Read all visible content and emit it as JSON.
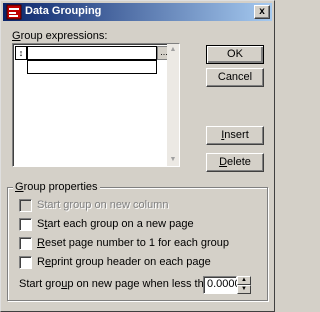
{
  "window": {
    "title": "Data Grouping",
    "close_glyph": "x"
  },
  "expressions": {
    "label_u": "G",
    "label_rest": "roup expressions:",
    "row_header_glyph": "↕",
    "ellipsis_button": "...",
    "scroll_up_glyph": "▲",
    "scroll_down_glyph": "▼"
  },
  "buttons": {
    "ok": "OK",
    "cancel": "Cancel",
    "insert_u": "I",
    "insert_rest": "nsert",
    "delete_u": "D",
    "delete_rest": "elete"
  },
  "group_properties": {
    "title_u": "G",
    "title_rest": "roup properties",
    "start_new_column": "Start group on new column",
    "start_new_page_pre": "S",
    "start_new_page_u": "t",
    "start_new_page_rest": "art each group on a new page",
    "reset_page_u": "R",
    "reset_page_rest": "eset page number to 1 for each group",
    "reprint_header_pre": "R",
    "reprint_header_u": "e",
    "reprint_header_rest": "print group header on each page",
    "start_when_less_pre": "Start gro",
    "start_when_less_u": "u",
    "start_when_less_rest": "p on new page when less than",
    "spin_value": "0.0000",
    "spin_up_glyph": "▲",
    "spin_down_glyph": "▼"
  }
}
